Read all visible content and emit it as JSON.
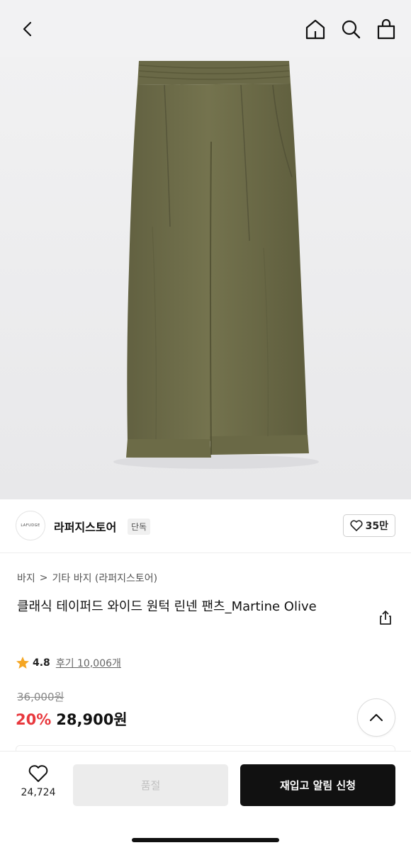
{
  "header": {
    "back_icon": "chevron-left-icon",
    "home_icon": "home-icon",
    "search_icon": "search-icon",
    "cart_icon": "shopping-bag-icon"
  },
  "product_image": {
    "subject": "olive wide pants",
    "color": "#6e6c48"
  },
  "seller": {
    "logo_text": "LAFUDGE",
    "name": "라퍼지스토어",
    "badge": "단독",
    "likes": "35만"
  },
  "breadcrumb": {
    "level1": "바지",
    "separator": ">",
    "level2": "기타 바지 (라퍼지스토어)"
  },
  "product": {
    "title": "클래식 테이퍼드 와이드 원턱 린넨 팬츠_Martine Olive",
    "rating": "4.8",
    "reviews": "후기 10,006개",
    "original_price": "36,000원",
    "discount": "20%",
    "price": "28,900원"
  },
  "bottom_bar": {
    "wish_count": "24,724",
    "soldout_label": "품절",
    "restock_label": "재입고 알림 신청"
  },
  "colors": {
    "accent_discount": "#e8383d",
    "primary_button": "#111111",
    "star": "#f5a623"
  }
}
